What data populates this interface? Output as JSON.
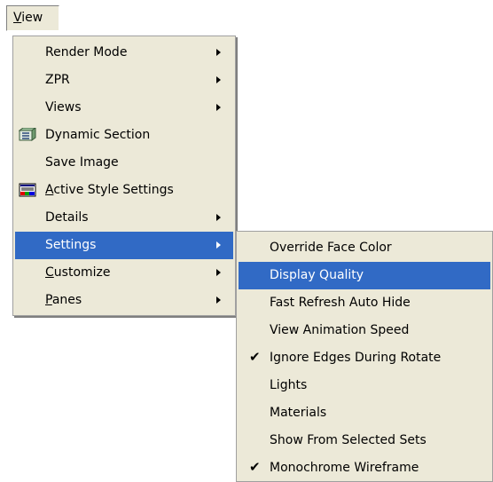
{
  "menubar": {
    "view_pre": "",
    "view_mnemonic": "V",
    "view_post": "iew"
  },
  "main_menu": {
    "render_mode": "Render Mode",
    "zpr": "ZPR",
    "views": "Views",
    "dynamic_section": "Dynamic Section",
    "save_image": "Save Image",
    "active_style_mnemonic": "A",
    "active_style_post": "ctive Style Settings",
    "details": "Details",
    "settings": "Settings",
    "customize_mnemonic": "C",
    "customize_post": "ustomize",
    "panes_mnemonic": "P",
    "panes_post": "anes"
  },
  "settings_submenu": {
    "override_face_color": "Override Face Color",
    "display_quality": "Display Quality",
    "fast_refresh_auto_hide": "Fast Refresh Auto Hide",
    "view_animation_speed": "View Animation Speed",
    "ignore_edges_during_rotate": "Ignore Edges During Rotate",
    "ignore_edges_checked": true,
    "lights": "Lights",
    "materials": "Materials",
    "show_from_selected_sets": "Show From Selected Sets",
    "monochrome_wireframe": "Monochrome Wireframe",
    "monochrome_checked": true,
    "check_glyph": "✔"
  },
  "colors": {
    "menu_bg": "#ece9d8",
    "highlight": "#316ac5",
    "highlight_text": "#ffffff"
  },
  "icons": [
    "submenu-arrow-icon",
    "dynamic-section-icon",
    "active-style-icon",
    "checkmark-icon"
  ]
}
